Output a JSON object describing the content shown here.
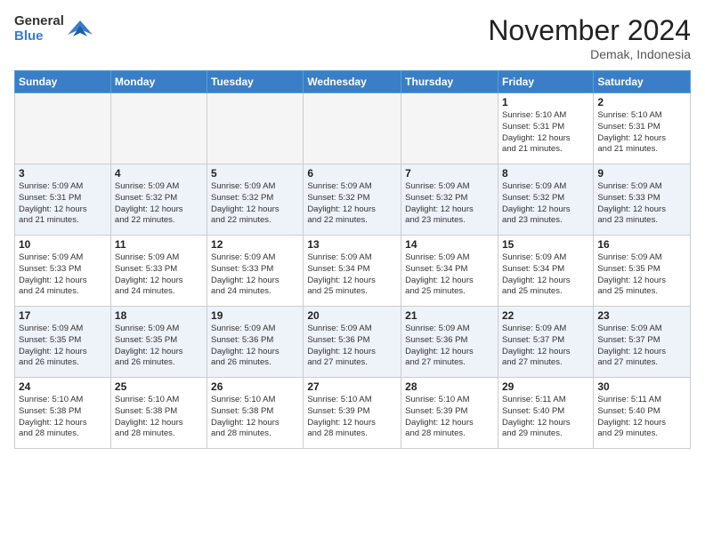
{
  "logo": {
    "general": "General",
    "blue": "Blue"
  },
  "header": {
    "title": "November 2024",
    "location": "Demak, Indonesia"
  },
  "weekdays": [
    "Sunday",
    "Monday",
    "Tuesday",
    "Wednesday",
    "Thursday",
    "Friday",
    "Saturday"
  ],
  "weeks": [
    [
      {
        "day": "",
        "info": ""
      },
      {
        "day": "",
        "info": ""
      },
      {
        "day": "",
        "info": ""
      },
      {
        "day": "",
        "info": ""
      },
      {
        "day": "",
        "info": ""
      },
      {
        "day": "1",
        "info": "Sunrise: 5:10 AM\nSunset: 5:31 PM\nDaylight: 12 hours\nand 21 minutes."
      },
      {
        "day": "2",
        "info": "Sunrise: 5:10 AM\nSunset: 5:31 PM\nDaylight: 12 hours\nand 21 minutes."
      }
    ],
    [
      {
        "day": "3",
        "info": "Sunrise: 5:09 AM\nSunset: 5:31 PM\nDaylight: 12 hours\nand 21 minutes."
      },
      {
        "day": "4",
        "info": "Sunrise: 5:09 AM\nSunset: 5:32 PM\nDaylight: 12 hours\nand 22 minutes."
      },
      {
        "day": "5",
        "info": "Sunrise: 5:09 AM\nSunset: 5:32 PM\nDaylight: 12 hours\nand 22 minutes."
      },
      {
        "day": "6",
        "info": "Sunrise: 5:09 AM\nSunset: 5:32 PM\nDaylight: 12 hours\nand 22 minutes."
      },
      {
        "day": "7",
        "info": "Sunrise: 5:09 AM\nSunset: 5:32 PM\nDaylight: 12 hours\nand 23 minutes."
      },
      {
        "day": "8",
        "info": "Sunrise: 5:09 AM\nSunset: 5:32 PM\nDaylight: 12 hours\nand 23 minutes."
      },
      {
        "day": "9",
        "info": "Sunrise: 5:09 AM\nSunset: 5:33 PM\nDaylight: 12 hours\nand 23 minutes."
      }
    ],
    [
      {
        "day": "10",
        "info": "Sunrise: 5:09 AM\nSunset: 5:33 PM\nDaylight: 12 hours\nand 24 minutes."
      },
      {
        "day": "11",
        "info": "Sunrise: 5:09 AM\nSunset: 5:33 PM\nDaylight: 12 hours\nand 24 minutes."
      },
      {
        "day": "12",
        "info": "Sunrise: 5:09 AM\nSunset: 5:33 PM\nDaylight: 12 hours\nand 24 minutes."
      },
      {
        "day": "13",
        "info": "Sunrise: 5:09 AM\nSunset: 5:34 PM\nDaylight: 12 hours\nand 25 minutes."
      },
      {
        "day": "14",
        "info": "Sunrise: 5:09 AM\nSunset: 5:34 PM\nDaylight: 12 hours\nand 25 minutes."
      },
      {
        "day": "15",
        "info": "Sunrise: 5:09 AM\nSunset: 5:34 PM\nDaylight: 12 hours\nand 25 minutes."
      },
      {
        "day": "16",
        "info": "Sunrise: 5:09 AM\nSunset: 5:35 PM\nDaylight: 12 hours\nand 25 minutes."
      }
    ],
    [
      {
        "day": "17",
        "info": "Sunrise: 5:09 AM\nSunset: 5:35 PM\nDaylight: 12 hours\nand 26 minutes."
      },
      {
        "day": "18",
        "info": "Sunrise: 5:09 AM\nSunset: 5:35 PM\nDaylight: 12 hours\nand 26 minutes."
      },
      {
        "day": "19",
        "info": "Sunrise: 5:09 AM\nSunset: 5:36 PM\nDaylight: 12 hours\nand 26 minutes."
      },
      {
        "day": "20",
        "info": "Sunrise: 5:09 AM\nSunset: 5:36 PM\nDaylight: 12 hours\nand 27 minutes."
      },
      {
        "day": "21",
        "info": "Sunrise: 5:09 AM\nSunset: 5:36 PM\nDaylight: 12 hours\nand 27 minutes."
      },
      {
        "day": "22",
        "info": "Sunrise: 5:09 AM\nSunset: 5:37 PM\nDaylight: 12 hours\nand 27 minutes."
      },
      {
        "day": "23",
        "info": "Sunrise: 5:09 AM\nSunset: 5:37 PM\nDaylight: 12 hours\nand 27 minutes."
      }
    ],
    [
      {
        "day": "24",
        "info": "Sunrise: 5:10 AM\nSunset: 5:38 PM\nDaylight: 12 hours\nand 28 minutes."
      },
      {
        "day": "25",
        "info": "Sunrise: 5:10 AM\nSunset: 5:38 PM\nDaylight: 12 hours\nand 28 minutes."
      },
      {
        "day": "26",
        "info": "Sunrise: 5:10 AM\nSunset: 5:38 PM\nDaylight: 12 hours\nand 28 minutes."
      },
      {
        "day": "27",
        "info": "Sunrise: 5:10 AM\nSunset: 5:39 PM\nDaylight: 12 hours\nand 28 minutes."
      },
      {
        "day": "28",
        "info": "Sunrise: 5:10 AM\nSunset: 5:39 PM\nDaylight: 12 hours\nand 28 minutes."
      },
      {
        "day": "29",
        "info": "Sunrise: 5:11 AM\nSunset: 5:40 PM\nDaylight: 12 hours\nand 29 minutes."
      },
      {
        "day": "30",
        "info": "Sunrise: 5:11 AM\nSunset: 5:40 PM\nDaylight: 12 hours\nand 29 minutes."
      }
    ]
  ]
}
